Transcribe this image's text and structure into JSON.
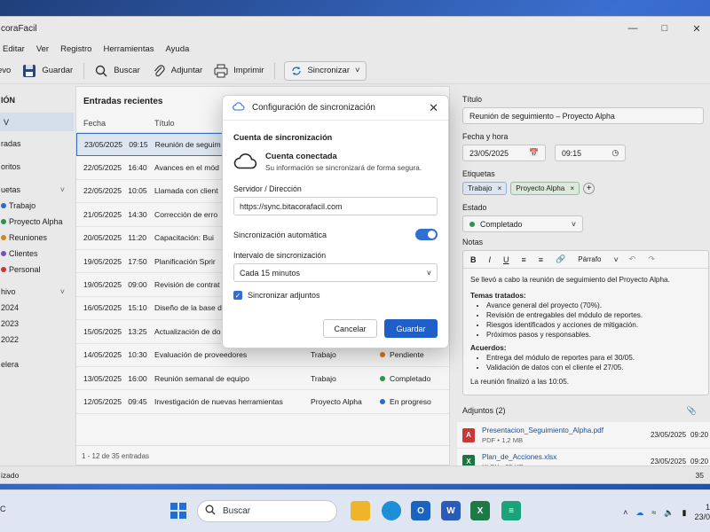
{
  "window": {
    "title": "coraFacil"
  },
  "menu": [
    "Editar",
    "Ver",
    "Registro",
    "Herramientas",
    "Ayuda"
  ],
  "toolbar": {
    "new": "evo",
    "save": "Guardar",
    "search": "Buscar",
    "attach": "Adjuntar",
    "print": "Imprimir",
    "sync": "Sincronizar"
  },
  "nav": {
    "section1": "IÓN",
    "item_v": "V",
    "entradas": "radas",
    "favoritos": "oritos",
    "etiquetas": "uetas",
    "tags": [
      {
        "label": "Trabajo",
        "color": "#2f6fd6"
      },
      {
        "label": "Proyecto Alpha",
        "color": "#2e9b4f"
      },
      {
        "label": "Reuniones",
        "color": "#e08a1e"
      },
      {
        "label": "Clientes",
        "color": "#7b54c9"
      },
      {
        "label": "Personal",
        "color": "#d23b3b"
      }
    ],
    "archivo": "hivo",
    "years": [
      "2024",
      "2023",
      "2022"
    ],
    "papelera": "elera"
  },
  "list": {
    "title": "Entradas recientes",
    "col_date": "Fecha",
    "col_title": "Título",
    "rows": [
      {
        "date": "23/05/2025",
        "time": "09:15",
        "title": "Reunión de seguim",
        "tag": "",
        "state": "",
        "state_color": ""
      },
      {
        "date": "22/05/2025",
        "time": "16:40",
        "title": "Avances en el mód",
        "tag": "",
        "state": "",
        "state_color": ""
      },
      {
        "date": "22/05/2025",
        "time": "10:05",
        "title": "Llamada con client",
        "tag": "",
        "state": "",
        "state_color": ""
      },
      {
        "date": "21/05/2025",
        "time": "14:30",
        "title": "Corrección de erro",
        "tag": "",
        "state": "",
        "state_color": ""
      },
      {
        "date": "20/05/2025",
        "time": "11:20",
        "title": "Capacitación: Bui",
        "tag": "",
        "state": "",
        "state_color": ""
      },
      {
        "date": "19/05/2025",
        "time": "17:50",
        "title": "Planificación Sprir",
        "tag": "",
        "state": "",
        "state_color": ""
      },
      {
        "date": "19/05/2025",
        "time": "09:00",
        "title": "Revisión de contrat",
        "tag": "",
        "state": "",
        "state_color": ""
      },
      {
        "date": "16/05/2025",
        "time": "15:10",
        "title": "Diseño de la base d",
        "tag": "",
        "state": "",
        "state_color": ""
      },
      {
        "date": "15/05/2025",
        "time": "13:25",
        "title": "Actualización de do",
        "tag": "",
        "state": "",
        "state_color": ""
      },
      {
        "date": "14/05/2025",
        "time": "10:30",
        "title": "Evaluación de proveedores",
        "tag": "Trabajo",
        "state": "Pendiente",
        "state_color": "#e07a1e"
      },
      {
        "date": "13/05/2025",
        "time": "16:00",
        "title": "Reunión semanal de equipo",
        "tag": "Trabajo",
        "state": "Completado",
        "state_color": "#2e9b4f"
      },
      {
        "date": "12/05/2025",
        "time": "09:45",
        "title": "Investigación de nuevas herramientas",
        "tag": "Proyecto Alpha",
        "state": "En progreso",
        "state_color": "#2f6fd6"
      }
    ],
    "footer": "1 - 12 de 35 entradas"
  },
  "detail": {
    "title_label": "Título",
    "title_value": "Reunión de seguimiento – Proyecto Alpha",
    "datetime_label": "Fecha y hora",
    "date_value": "23/05/2025",
    "time_value": "09:15",
    "tags_label": "Etiquetas",
    "tags": [
      "Trabajo",
      "Proyecto Alpha"
    ],
    "state_label": "Estado",
    "state_value": "Completado",
    "notes_label": "Notas",
    "editor": {
      "bold": "B",
      "italic": "I",
      "underline": "U",
      "paragraph": "Párrafo"
    },
    "notes": {
      "intro": "Se llevó a cabo la reunión de seguimiento del Proyecto Alpha.",
      "topics_title": "Temas tratados:",
      "topics": [
        "Avance general del proyecto (70%).",
        "Revisión de entregables del módulo de reportes.",
        "Riesgos identificados y acciones de mitigación.",
        "Próximos pasos y responsables."
      ],
      "agreements_title": "Acuerdos:",
      "agreements": [
        "Entrega del módulo de reportes para el 30/05.",
        "Validación de datos con el cliente el 27/05."
      ],
      "closing": "La reunión finalizó a las 10:05."
    },
    "attachments_label": "Adjuntos (2)",
    "attachments": [
      {
        "name": "Presentacion_Seguimiento_Alpha.pdf",
        "meta": "PDF  •  1,2 MB",
        "date": "23/05/2025",
        "time": "09:20",
        "color": "#d23b3b",
        "glyph": "A"
      },
      {
        "name": "Plan_de_Acciones.xlsx",
        "meta": "XLSX  •  85 KB",
        "date": "23/05/2025",
        "time": "09:20",
        "color": "#1e7a45",
        "glyph": "X"
      }
    ]
  },
  "status": {
    "left": "izado",
    "right": "35"
  },
  "dialog": {
    "title": "Configuración de sincronización",
    "section": "Cuenta de sincronización",
    "account_title": "Cuenta conectada",
    "account_sub": "Su información se sincronizará de forma segura.",
    "server_label": "Servidor / Dirección",
    "server_value": "https://sync.bitacorafacil.com",
    "auto_label": "Sincronización automática",
    "interval_label": "Intervalo de sincronización",
    "interval_value": "Cada 15 minutos",
    "attach_label": "Sincronizar adjuntos",
    "cancel": "Cancelar",
    "save": "Guardar"
  },
  "taskbar": {
    "weather_line1": "C",
    "search": "Buscar",
    "clock_time": "1",
    "clock_date": "23/0"
  }
}
